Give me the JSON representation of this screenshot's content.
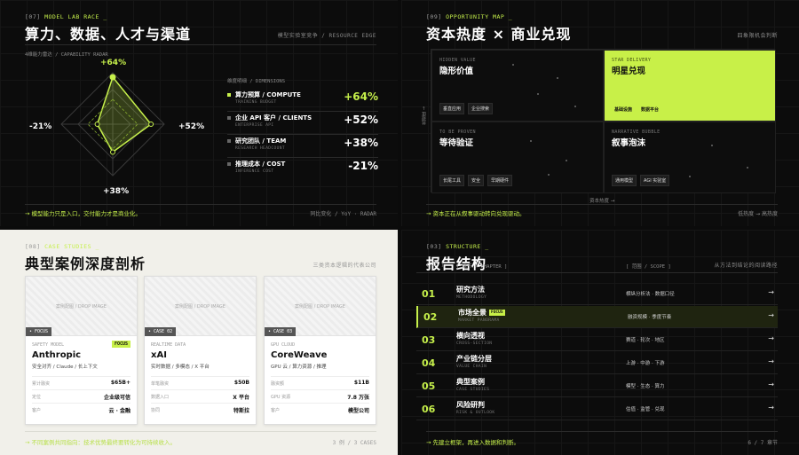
{
  "panel1": {
    "tag_num": "[07]",
    "tag_label": "MODEL LAB RACE _",
    "title": "算力、数据、人才与渠道",
    "right_note": "模型实验室竞争 / RESOURCE EDGE",
    "caption": "4维能力雷达 / CAPABILITY RADAR",
    "radar": {
      "top": "+64%",
      "right": "+52%",
      "bottom": "+38%",
      "left": "-21%"
    },
    "radar_values": [
      64,
      52,
      38,
      21
    ],
    "dims_header": "维度明细 / DIMENSIONS",
    "dims": [
      {
        "name": "算力预算 / COMPUTE",
        "sub": "TRAINING BUDGET",
        "value": "+64%"
      },
      {
        "name": "企业 API 客户 / CLIENTS",
        "sub": "ENTERPRISE API",
        "value": "+52%"
      },
      {
        "name": "研究团队 / TEAM",
        "sub": "RESEARCH HEADCOUNT",
        "value": "+38%"
      },
      {
        "name": "推理成本 / COST",
        "sub": "INFERENCE COST",
        "value": "-21%"
      }
    ],
    "footer": "→ 模型能力只是入口，交付能力才是商业化。",
    "footer_right": "同比变化 / YoY · RADAR"
  },
  "panel2": {
    "tag_num": "[09]",
    "tag_label": "OPPORTUNITY MAP _",
    "title": "资本热度 × 商业兑现",
    "right_note": "四象限机会判断",
    "quadrants": [
      {
        "label": "HIDDEN VALUE",
        "title": "隐形价值",
        "chips": [
          "垂直应用",
          "企业搜索"
        ]
      },
      {
        "label": "STAR DELIVERY",
        "title": "明星兑现",
        "chips": [
          "基础设施",
          "数据平台"
        ]
      },
      {
        "label": "TO BE PROVEN",
        "title": "等待验证",
        "chips": [
          "长尾工具",
          "安全",
          "早期硬件"
        ]
      },
      {
        "label": "NARRATIVE BUBBLE",
        "title": "叙事泡沫",
        "chips": [
          "通用模型",
          "AGI 实验室"
        ]
      }
    ],
    "y_axis": "兑现度 →",
    "x_axis": "资本热度 →",
    "footer": "→ 资本正在从叙事驱动转向兑现驱动。",
    "footer_right": "低热度 → 高热度"
  },
  "panel3": {
    "tag_num": "[08]",
    "tag_label": "CASE STUDIES _",
    "title": "典型案例深度剖析",
    "right_note": "三类资本逻辑的代表公司",
    "image_placeholder": "案例配图 / DROP IMAGE",
    "cards": [
      {
        "badge": "• FOCUS",
        "kind": "SAFETY MODEL",
        "focus": "FOCUS",
        "name": "Anthropic",
        "sub": "安全对齐 / Claude / 长上下文",
        "rows": [
          {
            "k": "累计融资",
            "v": "$65B+"
          },
          {
            "k": "定位",
            "v": "企业级可信"
          },
          {
            "k": "客户",
            "v": "云 · 金融"
          }
        ]
      },
      {
        "badge": "• CASE 02",
        "kind": "REALTIME DATA",
        "focus": "",
        "name": "xAI",
        "sub": "实时数据 / 多模态 / X 平台",
        "rows": [
          {
            "k": "单笔融资",
            "v": "$50B"
          },
          {
            "k": "数据入口",
            "v": "X 平台"
          },
          {
            "k": "协同",
            "v": "特斯拉"
          }
        ]
      },
      {
        "badge": "• CASE 03",
        "kind": "GPU CLOUD",
        "focus": "",
        "name": "CoreWeave",
        "sub": "GPU 云 / 算力资源 / 推理",
        "rows": [
          {
            "k": "融资额",
            "v": "$11B"
          },
          {
            "k": "GPU 资源",
            "v": "7.8 万张"
          },
          {
            "k": "客户",
            "v": "模型公司"
          }
        ]
      }
    ],
    "footer": "→ 不同案例共同指向：技术优势最终要转化为可持续收入。",
    "footer_right": "3 例 / 3 CASES"
  },
  "panel4": {
    "tag_num": "[03]",
    "tag_label": "STRUCTURE _",
    "title": "报告结构",
    "right_note": "从方法到结论的阅读路径",
    "col_id": "[ ID ]",
    "col_chapter": "[ 章节 / CHAPTER ]",
    "col_scope": "[ 范围 / SCOPE ]",
    "rows": [
      {
        "id": "01",
        "name": "研究方法",
        "en": "METHODOLOGY",
        "scope": "横纵分析法 · 数据口径",
        "focus": ""
      },
      {
        "id": "02",
        "name": "市场全景",
        "en": "MARKET PANORAMA",
        "scope": "融资规模 · 季度节奏",
        "focus": "FOCUS"
      },
      {
        "id": "03",
        "name": "横向透视",
        "en": "CROSS-SECTION",
        "scope": "赛道 · 轮次 · 地区",
        "focus": ""
      },
      {
        "id": "04",
        "name": "产业链分层",
        "en": "VALUE CHAIN",
        "scope": "上游 · 中游 · 下游",
        "focus": ""
      },
      {
        "id": "05",
        "name": "典型案例",
        "en": "CASE STUDIES",
        "scope": "模型 · 生态 · 算力",
        "focus": ""
      },
      {
        "id": "06",
        "name": "风险研判",
        "en": "RISK & OUTLOOK",
        "scope": "估值 · 监管 · 兑现",
        "focus": ""
      }
    ],
    "arrow": "→",
    "footer": "→ 先建立框架，再进入数据和判断。",
    "footer_right": "6 / 7 章节"
  },
  "colors": {
    "accent": "#c6f04b",
    "bg": "#0c0c0c",
    "light_bg": "#f1f0ea"
  }
}
